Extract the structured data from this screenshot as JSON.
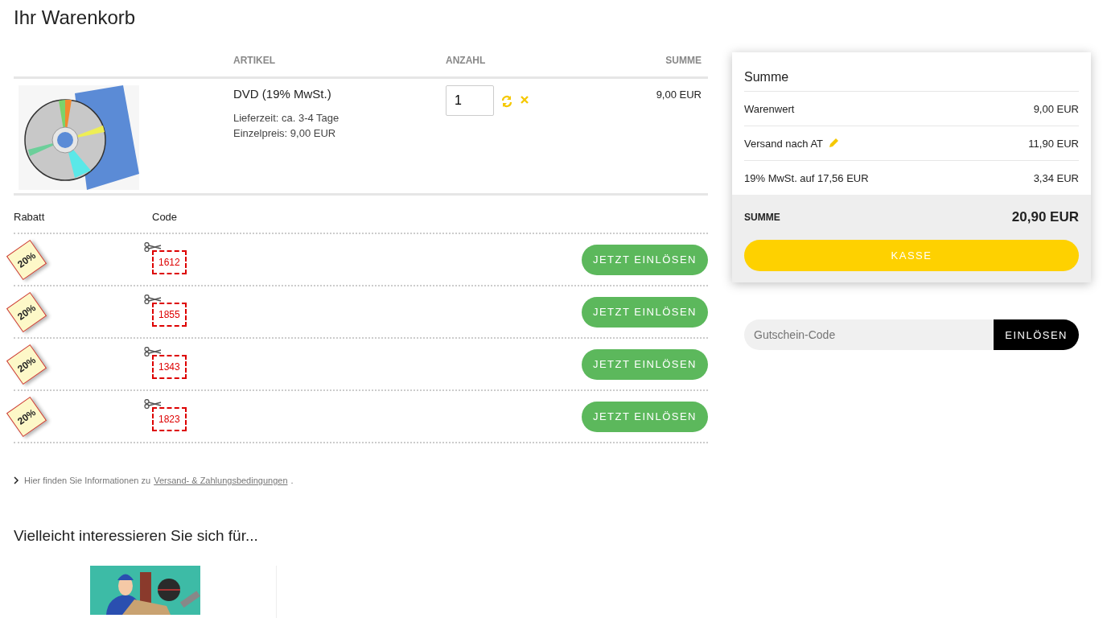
{
  "title": "Ihr Warenkorb",
  "cart": {
    "columns": [
      "ARTIKEL",
      "ANZAHL",
      "SUMME"
    ],
    "items": [
      {
        "image": {
          "kind": "picture"
        },
        "name": "DVD (19% MwSt.)",
        "details": [
          "Lieferzeit: ca. 3-4 Tage",
          "Einzelpreis: 9,00 EUR"
        ],
        "quantity": "1",
        "total": "9,00 EUR"
      }
    ]
  },
  "coupons": {
    "columns": [
      "Rabatt",
      "Code"
    ],
    "rows": [
      {
        "badge": "20%",
        "code": "1612",
        "button": "JETZT EINLÖSEN"
      },
      {
        "badge": "20%",
        "code": "1855",
        "button": "JETZT EINLÖSEN"
      },
      {
        "badge": "20%",
        "code": "1343",
        "button": "JETZT EINLÖSEN"
      },
      {
        "badge": "20%",
        "code": "1823",
        "button": "JETZT EINLÖSEN"
      }
    ]
  },
  "info": {
    "text": "Hier finden Sie Informationen zu",
    "link": "Versand- & Zahlungsbedingungen",
    "end": "."
  },
  "suggestions": {
    "title": "Vielleicht interessieren Sie sich für...",
    "items": [
      {
        "kind": "picture"
      }
    ]
  },
  "summary": {
    "title": "Summe",
    "lines": [
      {
        "label": "Warenwert",
        "value": "9,00 EUR",
        "editable": false
      },
      {
        "label": "Versand nach AT",
        "value": "11,90 EUR",
        "editable": true
      },
      {
        "label": "19% MwSt. auf 17,56 EUR",
        "value": "3,34 EUR",
        "editable": false
      }
    ],
    "total_label": "SUMME",
    "total_value": "20,90 EUR",
    "checkout": "KASSE"
  },
  "voucher": {
    "placeholder": "Gutschein-Code",
    "button": "EINLÖSEN"
  }
}
